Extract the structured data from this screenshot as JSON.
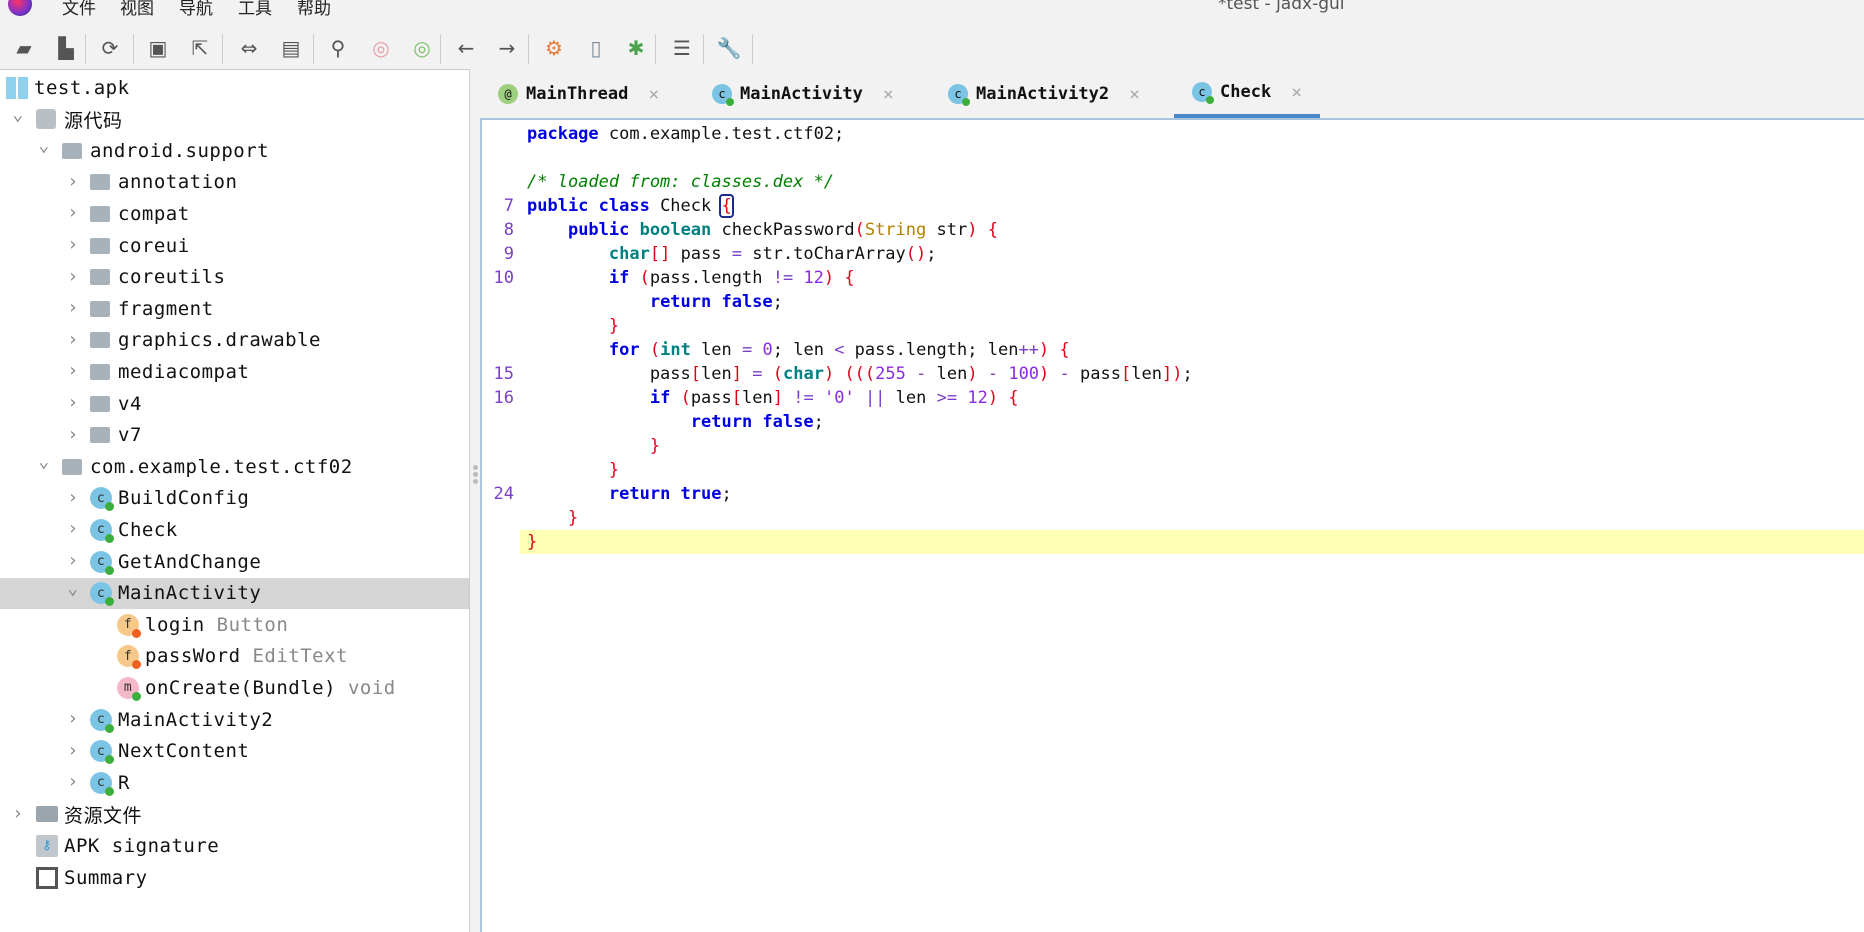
{
  "app": {
    "title": "*test - jadx-gui"
  },
  "menu": [
    "文件",
    "视图",
    "导航",
    "工具",
    "帮助"
  ],
  "toolbar": [
    "open-folder",
    "add-files",
    "reload",
    "save",
    "export",
    "sync",
    "decompile-folder",
    "search",
    "search-class",
    "search-usage",
    "back",
    "forward",
    "deobfuscation",
    "device",
    "debug",
    "log",
    "preferences"
  ],
  "tree": [
    {
      "label": "test.apk",
      "level": 0,
      "icon": "apk",
      "chev": ""
    },
    {
      "label": "源代码",
      "level": 1,
      "icon": "package",
      "chev": "open"
    },
    {
      "label": "android.support",
      "level": 2,
      "icon": "pkg",
      "chev": "open"
    },
    {
      "label": "annotation",
      "level": 3,
      "icon": "pkg",
      "chev": "closed"
    },
    {
      "label": "compat",
      "level": 3,
      "icon": "pkg",
      "chev": "closed"
    },
    {
      "label": "coreui",
      "level": 3,
      "icon": "pkg",
      "chev": "closed"
    },
    {
      "label": "coreutils",
      "level": 3,
      "icon": "pkg",
      "chev": "closed"
    },
    {
      "label": "fragment",
      "level": 3,
      "icon": "pkg",
      "chev": "closed"
    },
    {
      "label": "graphics.drawable",
      "level": 3,
      "icon": "pkg",
      "chev": "closed"
    },
    {
      "label": "mediacompat",
      "level": 3,
      "icon": "pkg",
      "chev": "closed"
    },
    {
      "label": "v4",
      "level": 3,
      "icon": "pkg",
      "chev": "closed"
    },
    {
      "label": "v7",
      "level": 3,
      "icon": "pkg",
      "chev": "closed"
    },
    {
      "label": "com.example.test.ctf02",
      "level": 2,
      "icon": "pkg",
      "chev": "open"
    },
    {
      "label": "BuildConfig",
      "level": 3,
      "icon": "c",
      "chev": "closed"
    },
    {
      "label": "Check",
      "level": 3,
      "icon": "c",
      "chev": "closed"
    },
    {
      "label": "GetAndChange",
      "level": 3,
      "icon": "c",
      "chev": "closed"
    },
    {
      "label": "MainActivity",
      "level": 3,
      "icon": "c",
      "chev": "open",
      "selected": true
    },
    {
      "label": "login",
      "sub": "Button",
      "level": 4,
      "icon": "f",
      "chev": ""
    },
    {
      "label": "passWord",
      "sub": "EditText",
      "level": 4,
      "icon": "f",
      "chev": ""
    },
    {
      "label": "onCreate(Bundle)",
      "sub": "void",
      "level": 4,
      "icon": "m",
      "chev": ""
    },
    {
      "label": "MainActivity2",
      "level": 3,
      "icon": "c",
      "chev": "closed"
    },
    {
      "label": "NextContent",
      "level": 3,
      "icon": "c",
      "chev": "closed"
    },
    {
      "label": "R",
      "level": 3,
      "icon": "c",
      "chev": "closed"
    },
    {
      "label": "资源文件",
      "level": 1,
      "icon": "folder",
      "chev": "closed"
    },
    {
      "label": "APK signature",
      "level": 1,
      "icon": "signature",
      "chev": ""
    },
    {
      "label": "Summary",
      "level": 1,
      "icon": "summary",
      "chev": ""
    }
  ],
  "tabs": [
    {
      "label": "MainThread",
      "icon": "@",
      "active": false
    },
    {
      "label": "MainActivity",
      "icon": "c",
      "active": false
    },
    {
      "label": "MainActivity2",
      "icon": "c",
      "active": false
    },
    {
      "label": "Check",
      "icon": "c",
      "active": true
    }
  ],
  "code": [
    {
      "n": "",
      "t": [
        [
          "package",
          "kw"
        ],
        [
          " com.example.test.ctf02;",
          "pl"
        ]
      ]
    },
    {
      "n": "",
      "t": []
    },
    {
      "n": "",
      "t": [
        [
          "/* loaded from: classes.dex */",
          "cm"
        ]
      ]
    },
    {
      "n": "7",
      "t": [
        [
          "public class",
          "kw"
        ],
        [
          " Check ",
          "pl"
        ],
        [
          "{",
          "br"
        ]
      ]
    },
    {
      "n": "8",
      "t": [
        [
          "    ",
          "pl"
        ],
        [
          "public",
          "kw"
        ],
        [
          " ",
          "pl"
        ],
        [
          "boolean",
          "ty"
        ],
        [
          " checkPassword",
          "pl"
        ],
        [
          "(",
          "pa"
        ],
        [
          "String",
          "st"
        ],
        [
          " str",
          "pl"
        ],
        [
          ")",
          "pa"
        ],
        [
          " ",
          "pl"
        ],
        [
          "{",
          "pa"
        ]
      ]
    },
    {
      "n": "9",
      "t": [
        [
          "        ",
          "pl"
        ],
        [
          "char",
          "ty"
        ],
        [
          "[]",
          "pa"
        ],
        [
          " pass ",
          "pl"
        ],
        [
          "=",
          "op"
        ],
        [
          " str.toCharArray",
          "pl"
        ],
        [
          "()",
          "pa"
        ],
        [
          ";",
          "pl"
        ]
      ]
    },
    {
      "n": "10",
      "t": [
        [
          "        ",
          "pl"
        ],
        [
          "if",
          "kw"
        ],
        [
          " ",
          "pl"
        ],
        [
          "(",
          "pa"
        ],
        [
          "pass.length ",
          "pl"
        ],
        [
          "!=",
          "op"
        ],
        [
          " ",
          "pl"
        ],
        [
          "12",
          "nu"
        ],
        [
          ")",
          "pa"
        ],
        [
          " ",
          "pl"
        ],
        [
          "{",
          "pa"
        ]
      ]
    },
    {
      "n": "",
      "t": [
        [
          "            ",
          "pl"
        ],
        [
          "return false",
          "kw"
        ],
        [
          ";",
          "pl"
        ]
      ]
    },
    {
      "n": "",
      "t": [
        [
          "        ",
          "pl"
        ],
        [
          "}",
          "pa"
        ]
      ]
    },
    {
      "n": "",
      "t": [
        [
          "        ",
          "pl"
        ],
        [
          "for",
          "kw"
        ],
        [
          " ",
          "pl"
        ],
        [
          "(",
          "pa"
        ],
        [
          "int",
          "ty"
        ],
        [
          " len ",
          "pl"
        ],
        [
          "=",
          "op"
        ],
        [
          " ",
          "pl"
        ],
        [
          "0",
          "nu"
        ],
        [
          "; len ",
          "pl"
        ],
        [
          "<",
          "op"
        ],
        [
          " pass.length; len",
          "pl"
        ],
        [
          "++",
          "op"
        ],
        [
          ")",
          "pa"
        ],
        [
          " ",
          "pl"
        ],
        [
          "{",
          "pa"
        ]
      ]
    },
    {
      "n": "15",
      "t": [
        [
          "            pass",
          "pl"
        ],
        [
          "[",
          "pa"
        ],
        [
          "len",
          "pl"
        ],
        [
          "]",
          "pa"
        ],
        [
          " ",
          "pl"
        ],
        [
          "=",
          "op"
        ],
        [
          " ",
          "pl"
        ],
        [
          "(",
          "pa"
        ],
        [
          "char",
          "ty"
        ],
        [
          ")",
          "pa"
        ],
        [
          " ",
          "pl"
        ],
        [
          "(((",
          "pa"
        ],
        [
          "255",
          "nu"
        ],
        [
          " ",
          "pl"
        ],
        [
          "-",
          "op"
        ],
        [
          " len",
          "pl"
        ],
        [
          ")",
          "pa"
        ],
        [
          " ",
          "pl"
        ],
        [
          "-",
          "op"
        ],
        [
          " ",
          "pl"
        ],
        [
          "100",
          "nu"
        ],
        [
          ")",
          "pa"
        ],
        [
          " ",
          "pl"
        ],
        [
          "-",
          "op"
        ],
        [
          " pass",
          "pl"
        ],
        [
          "[",
          "pa"
        ],
        [
          "len",
          "pl"
        ],
        [
          "])",
          "pa"
        ],
        [
          ";",
          "pl"
        ]
      ]
    },
    {
      "n": "16",
      "t": [
        [
          "            ",
          "pl"
        ],
        [
          "if",
          "kw"
        ],
        [
          " ",
          "pl"
        ],
        [
          "(",
          "pa"
        ],
        [
          "pass",
          "pl"
        ],
        [
          "[",
          "pa"
        ],
        [
          "len",
          "pl"
        ],
        [
          "]",
          "pa"
        ],
        [
          " ",
          "pl"
        ],
        [
          "!=",
          "op"
        ],
        [
          " ",
          "pl"
        ],
        [
          "'0'",
          "nu"
        ],
        [
          " ",
          "pl"
        ],
        [
          "||",
          "op"
        ],
        [
          " len ",
          "pl"
        ],
        [
          ">=",
          "op"
        ],
        [
          " ",
          "pl"
        ],
        [
          "12",
          "nu"
        ],
        [
          ")",
          "pa"
        ],
        [
          " ",
          "pl"
        ],
        [
          "{",
          "pa"
        ]
      ]
    },
    {
      "n": "",
      "t": [
        [
          "                ",
          "pl"
        ],
        [
          "return false",
          "kw"
        ],
        [
          ";",
          "pl"
        ]
      ]
    },
    {
      "n": "",
      "t": [
        [
          "            ",
          "pl"
        ],
        [
          "}",
          "pa"
        ]
      ]
    },
    {
      "n": "",
      "t": [
        [
          "        ",
          "pl"
        ],
        [
          "}",
          "pa"
        ]
      ]
    },
    {
      "n": "24",
      "t": [
        [
          "        ",
          "pl"
        ],
        [
          "return true",
          "kw"
        ],
        [
          ";",
          "pl"
        ]
      ]
    },
    {
      "n": "",
      "t": [
        [
          "    ",
          "pl"
        ],
        [
          "}",
          "pa"
        ]
      ]
    },
    {
      "n": "",
      "t": [
        [
          "}",
          "pa"
        ]
      ],
      "highlight": true
    }
  ]
}
